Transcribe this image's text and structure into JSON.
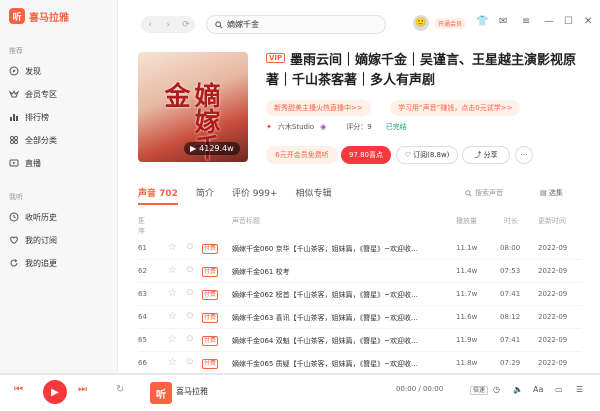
{
  "app": {
    "name": "喜马拉雅",
    "logo_char": "听"
  },
  "sidebar": {
    "section_recommend": "推荐",
    "items": [
      {
        "label": "发现",
        "icon": "compass-icon"
      },
      {
        "label": "会员专区",
        "icon": "vip-icon"
      },
      {
        "label": "排行榜",
        "icon": "ranking-icon"
      },
      {
        "label": "全部分类",
        "icon": "category-icon"
      },
      {
        "label": "直播",
        "icon": "live-icon"
      }
    ],
    "section_mine": "我听",
    "my_items": [
      {
        "label": "收听历史",
        "icon": "history-icon"
      },
      {
        "label": "我的订阅",
        "icon": "subscribe-icon"
      },
      {
        "label": "我的追更",
        "icon": "refresh-icon"
      }
    ]
  },
  "topbar": {
    "search_value": "嫡嫁千金",
    "vip_open": "开通会员"
  },
  "album": {
    "vip_tag": "VIP",
    "title": "墨雨云间｜嫡嫁千金｜吴谨言、王星越主演影视原著｜千山茶客著｜多人有声剧",
    "cover_title": "嫡嫁千金",
    "cover_plays": "4129.4w",
    "promo1": "新秀甜美主播火热直播中>>",
    "promo2": "学习用“声音”赚钱，点击0元试学>>",
    "author": "六木Studio",
    "rating_label": "评分：9",
    "status": "已完结",
    "btn_vip": "6元开会员免费听",
    "btn_buy": "97.80喜点",
    "btn_subscribe": "订阅(8.8w)",
    "btn_share": "分享"
  },
  "tabs": [
    {
      "label": "声音 702",
      "active": true
    },
    {
      "label": "简介",
      "active": false
    },
    {
      "label": "评价 999+",
      "active": false
    },
    {
      "label": "相似专辑",
      "active": false
    }
  ],
  "track_search_placeholder": "搜索声音",
  "select_all": "选集",
  "table": {
    "headers": {
      "order": "正序",
      "title": "声音标题",
      "plays": "播放量",
      "duration": "时长",
      "updated": "更新时间"
    },
    "paid_tag": "付费",
    "rows": [
      {
        "no": "61",
        "title": "嫡嫁千金060 京华【千山茶客，姐妹篇，《簪星》~欢迎收…",
        "plays": "11.1w",
        "duration": "08:00",
        "date": "2022-09"
      },
      {
        "no": "62",
        "title": "嫡嫁千金061 校考",
        "plays": "11.4w",
        "duration": "07:53",
        "date": "2022-09"
      },
      {
        "no": "63",
        "title": "嫡嫁千金062 榜首【千山茶客，姐妹篇，《簪星》~欢迎收…",
        "plays": "11.7w",
        "duration": "07:41",
        "date": "2022-09"
      },
      {
        "no": "64",
        "title": "嫡嫁千金063 喜讯【千山茶客，姐妹篇，《簪星》~欢迎收…",
        "plays": "11.6w",
        "duration": "08:12",
        "date": "2022-09"
      },
      {
        "no": "65",
        "title": "嫡嫁千金064 双魁【千山茶客，姐妹篇，《簪星》~欢迎收…",
        "plays": "11.9w",
        "duration": "07:41",
        "date": "2022-09"
      },
      {
        "no": "66",
        "title": "嫡嫁千金065 质疑【千山茶客，姐妹篇，《簪星》~欢迎收…",
        "plays": "11.8w",
        "duration": "07:29",
        "date": "2022-09"
      }
    ]
  },
  "player": {
    "track_name": "喜马拉雅",
    "time": "00:00 / 00:00",
    "speed": "倍速"
  }
}
